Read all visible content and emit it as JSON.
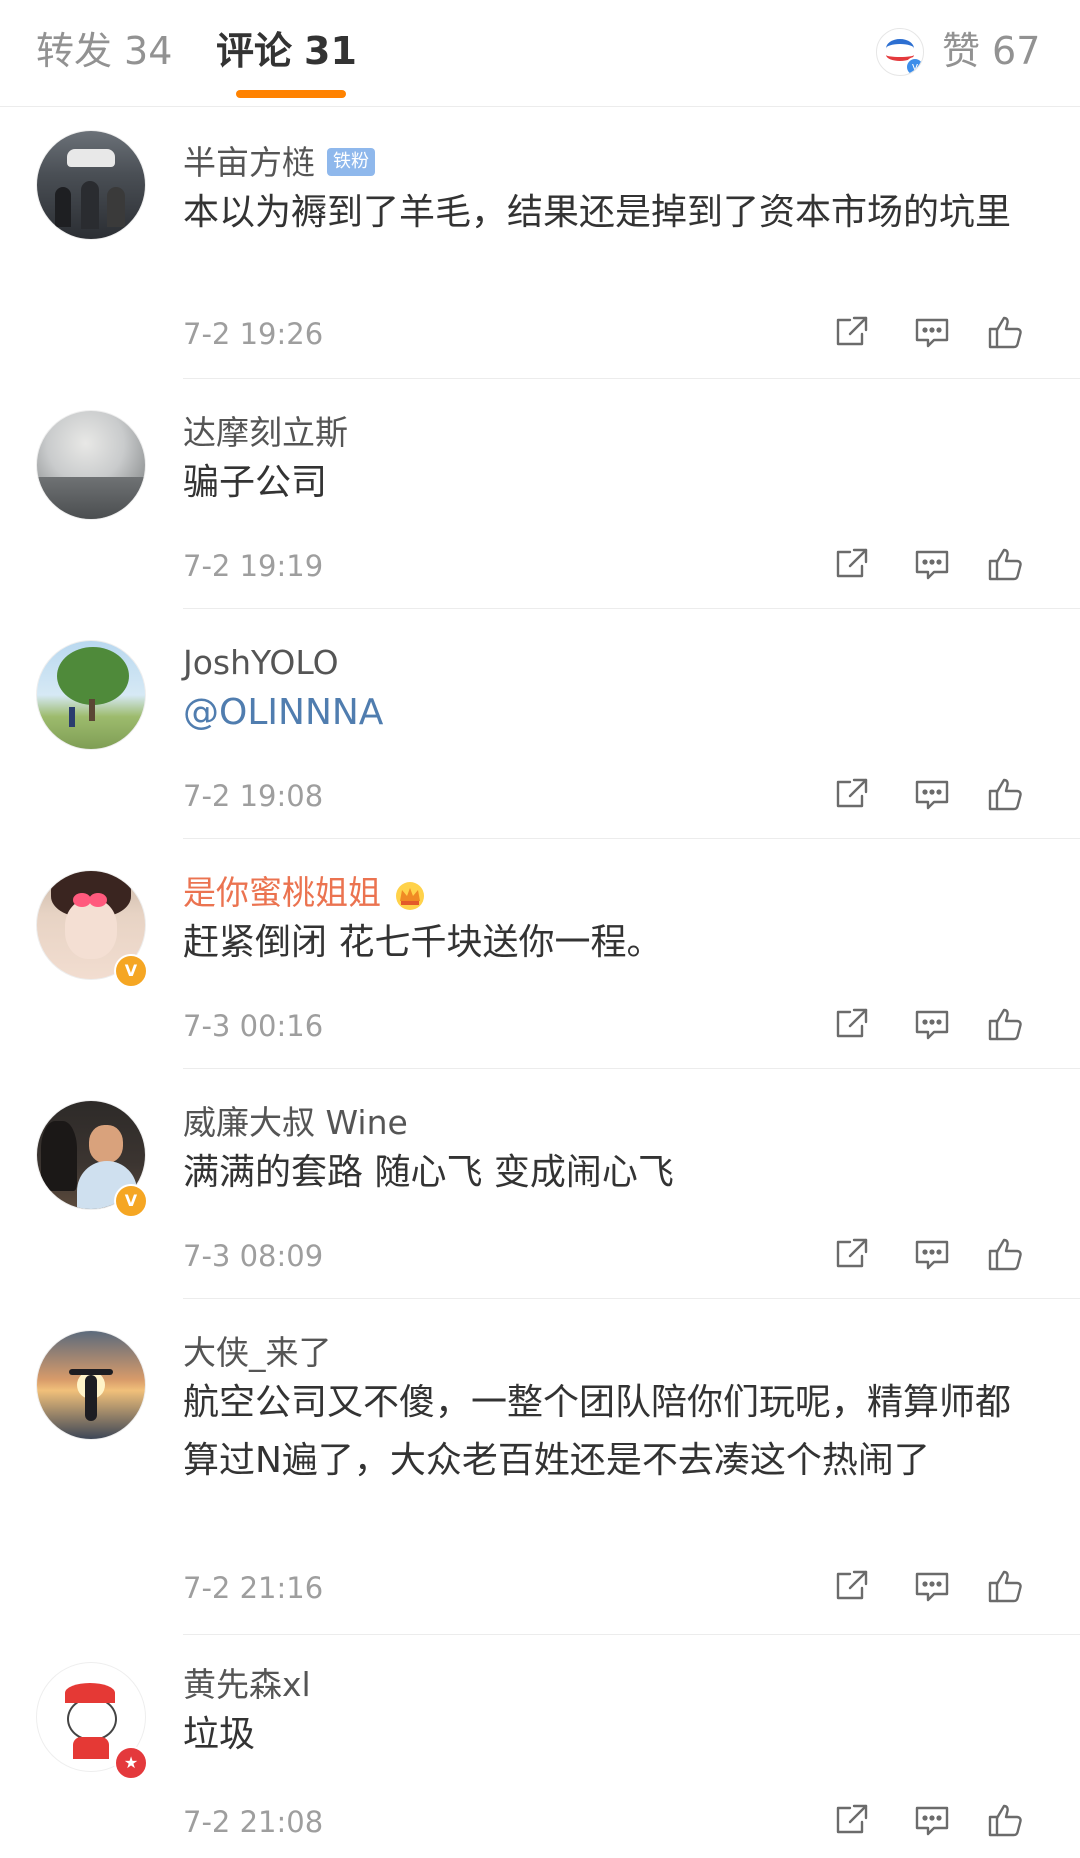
{
  "tabs": {
    "repost": {
      "label": "转发",
      "count": "34"
    },
    "comment": {
      "label": "评论",
      "count": "31"
    },
    "like": {
      "label": "赞",
      "count": "67"
    }
  },
  "comments": [
    {
      "name": "半亩方梿",
      "tag": "铁粉",
      "content": "本以为褥到了羊毛，结果还是掉到了资本市场的坑里",
      "time": "7-2 19:26"
    },
    {
      "name": "达摩刻立斯",
      "content": "骗子公司",
      "time": "7-2 19:19"
    },
    {
      "name": "JoshYOLO",
      "content": "@OLINNNA",
      "time": "7-2 19:08"
    },
    {
      "name": "是你蜜桃姐姐",
      "content": "赶紧倒闭 花七千块送你一程。",
      "time": "7-3 00:16"
    },
    {
      "name": "威廉大叔 Wine",
      "content": "满满的套路 随心飞 变成闹心飞",
      "time": "7-3 08:09"
    },
    {
      "name": "大侠_来了",
      "content": "航空公司又不傻，一整个团队陪你们玩呢，精算师都算过N遍了，大众老百姓还是不去凑这个热闹了",
      "time": "7-2 21:16"
    },
    {
      "name": "黄先森xl",
      "content": "垃圾",
      "time": "7-2 21:08"
    }
  ],
  "colors": {
    "accent": "#ff8200",
    "link": "#507daf",
    "vip_name": "#eb7350",
    "text": "#333333",
    "muted": "#9e9e9e"
  },
  "icons": [
    "repost-icon",
    "comment-icon",
    "like-icon",
    "verified-badge-icon",
    "crown-icon"
  ]
}
